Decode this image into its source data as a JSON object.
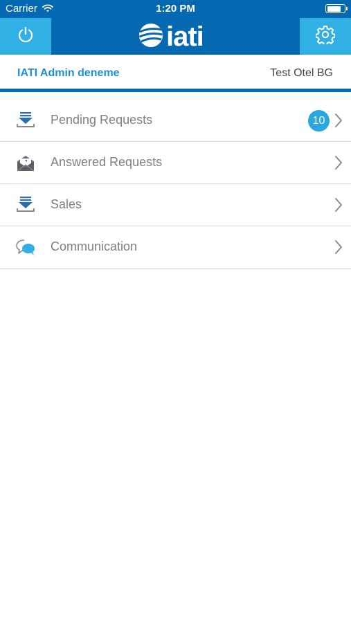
{
  "status_bar": {
    "carrier": "Carrier",
    "time": "1:20 PM",
    "battery_level": 0.85
  },
  "nav": {
    "logo_text": "iati",
    "power_icon": "power-icon",
    "settings_icon": "gear-icon"
  },
  "account": {
    "user_name": "IATI Admin deneme",
    "hotel_name": "Test Otel BG"
  },
  "menu": {
    "items": [
      {
        "label": "Pending Requests",
        "icon": "download-tray-icon",
        "badge": "10"
      },
      {
        "label": "Answered Requests",
        "icon": "envelope-open-icon"
      },
      {
        "label": "Sales",
        "icon": "download-tray-icon"
      },
      {
        "label": "Communication",
        "icon": "chat-bubbles-icon"
      }
    ]
  },
  "colors": {
    "nav_background": "#0569b1",
    "nav_button_background": "#31b0e6",
    "account_name": "#1f8fd0",
    "badge_background": "#2aa7e0",
    "label_text": "#7f7f7f",
    "divider": "#c9e6f5"
  }
}
